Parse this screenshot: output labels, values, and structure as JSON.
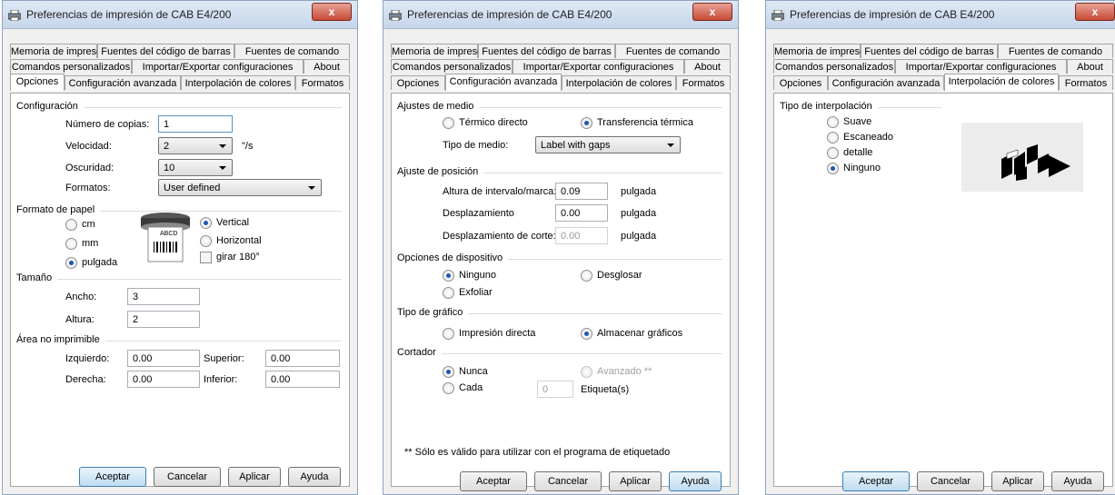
{
  "title": "Preferencias de impresión de CAB E4/200",
  "close_glyph": "x",
  "tabs": {
    "row1": [
      "Memoria de impresora",
      "Fuentes del código de barras",
      "Fuentes de comando"
    ],
    "row2": [
      "Comandos personalizados",
      "Importar/Exportar configuraciones",
      "About"
    ],
    "row3": [
      "Opciones",
      "Configuración avanzada",
      "Interpolación de colores",
      "Formatos"
    ]
  },
  "buttons": {
    "ok": "Aceptar",
    "cancel": "Cancelar",
    "apply": "Aplicar",
    "help": "Ayuda"
  },
  "opciones": {
    "configuracion": {
      "group": "Configuración",
      "copies_label": "Número de copias:",
      "copies_value": "1",
      "speed_label": "Velocidad:",
      "speed_value": "2",
      "speed_unit": "\"/s",
      "darkness_label": "Oscuridad:",
      "darkness_value": "10",
      "formats_label": "Formatos:",
      "formats_value": "User defined"
    },
    "paper": {
      "group": "Formato de papel",
      "cm": "cm",
      "mm": "mm",
      "inch": "pulgada",
      "vertical": "Vertical",
      "horizontal": "Horizontal",
      "rotate": "girar 180°",
      "sample_text": "ABCD",
      "selected_unit": "pulgada",
      "selected_orientation": "Vertical"
    },
    "size": {
      "group": "Tamaño",
      "width_label": "Ancho:",
      "width_value": "3",
      "height_label": "Altura:",
      "height_value": "2"
    },
    "unprintable": {
      "group": "Área no imprimible",
      "left_label": "Izquierdo:",
      "left_value": "0.00",
      "top_label": "Superior:",
      "top_value": "0.00",
      "right_label": "Derecha:",
      "right_value": "0.00",
      "bottom_label": "Inferior:",
      "bottom_value": "0.00"
    }
  },
  "avanzada": {
    "media": {
      "group": "Ajustes de medio",
      "direct": "Térmico directo",
      "transfer": "Transferencia térmica",
      "selected": "Transferencia térmica",
      "type_label": "Tipo de medio:",
      "type_value": "Label with gaps"
    },
    "position": {
      "group": "Ajuste de posición",
      "gap_label": "Altura de intervalo/marca:",
      "gap_value": "0.09",
      "gap_unit": "pulgada",
      "offset_label": "Desplazamiento",
      "offset_value": "0.00",
      "offset_unit": "pulgada",
      "cut_label": "Desplazamiento de corte:",
      "cut_value": "0.00",
      "cut_unit": "pulgada"
    },
    "device": {
      "group": "Opciones de dispositivo",
      "none": "Ninguno",
      "tear": "Desglosar",
      "peel": "Exfoliar",
      "selected": "Ninguno"
    },
    "graphics": {
      "group": "Tipo de gráfico",
      "direct": "Impresión directa",
      "store": "Almacenar gráficos",
      "selected": "Almacenar gráficos"
    },
    "cutter": {
      "group": "Cortador",
      "never": "Nunca",
      "advanced": "Avanzado **",
      "each": "Cada",
      "each_value": "0",
      "each_unit": "Etiqueta(s)",
      "selected": "Nunca"
    },
    "note": "** Sólo es válido para utilizar con el programa de etiquetado"
  },
  "interpolacion": {
    "group": "Tipo de interpolación",
    "options": [
      "Suave",
      "Escaneado",
      "detalle",
      "Ninguno"
    ],
    "selected": "Ninguno"
  }
}
